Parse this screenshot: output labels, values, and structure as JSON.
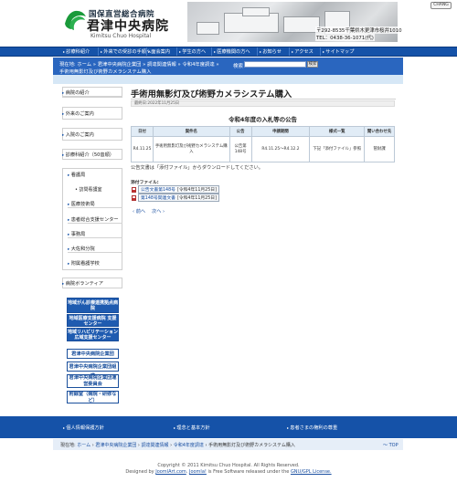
{
  "header": {
    "logo_sub": "国保直営総合病院",
    "logo_main": "君津中央病院",
    "logo_en": "Kimitsu Chuo Hospital",
    "address": "〒292-8535千葉県木更津市桜井1010",
    "phone": "TEL：0438-36-1071(代)",
    "top_button": "CHANG"
  },
  "nav": {
    "items": [
      "診療科紹介",
      "外来での受診の手順へ",
      "面会案内",
      "学生の方へ",
      "医療機関の方へ",
      "お知らせ",
      "アクセス",
      "サイトマップ"
    ]
  },
  "breadcrumb": {
    "prefix": "現在地:",
    "items": [
      "ホーム",
      "君津中央病院企業団",
      "調達関連情報",
      "令和4年度調達",
      "手術用無影灯及び術野カメラシステム購入"
    ],
    "separator": "»"
  },
  "search": {
    "label": "検索",
    "placeholder": "",
    "button": "検索"
  },
  "sidebar": {
    "items": [
      "病院の紹介",
      "外来のご案内",
      "入院のご案内",
      "診療科紹介（50音順）"
    ],
    "section_items": [
      "看護局"
    ],
    "child_items": [
      "訪問看護室"
    ],
    "more_items": [
      "医療技術局",
      "患者総合支援センター",
      "事務局",
      "大佐和分院",
      "附属看護学校"
    ],
    "volunteer": "病院ボランティア",
    "banners": [
      "地域がん診療連携拠点病院",
      "地域医療支援病院 支援センター",
      "地域リハビリテーション広域支援センター"
    ],
    "banners2": [
      "君津中央病院企業団",
      "君津中央病院企業団組織",
      "君津中央病院企業団運営委員会",
      "附録室（病院・研修など）"
    ]
  },
  "main": {
    "title": "手術用無影灯及び術野カメラシステム購入",
    "date": "最終日:2022年11月25日",
    "notice_title": "令和4年度の入札等の公告",
    "table": {
      "headers": [
        "日付",
        "案件名",
        "公告",
        "申請期間",
        "様式一覧",
        "閲い合わせ先"
      ],
      "rows": [
        [
          "R4.11.25",
          "手術用無影灯及び術野カメラシステム購入",
          "公告第148号",
          "R4.11.25～R4.12.2",
          "下記「添付ファイル」参照",
          "管財課"
        ]
      ]
    },
    "download_note": "公告文書は「添付ファイル」からダウンロードしてください。",
    "attach_label": "添付ファイル:",
    "attachments": [
      {
        "name": "公告文書第148号",
        "date": "[令和4年11月25日]"
      },
      {
        "name": "第148号関連文書",
        "date": "[令和4年11月25日]"
      }
    ],
    "prev": "前へ",
    "next": "次へ"
  },
  "footer": {
    "links": [
      "個人情報保護方針",
      "理念と基本方針",
      "患者さまの権利の尊重"
    ],
    "crumb_prefix": "現在地:",
    "crumb_items": [
      "ホーム",
      "君津中央病院企業団",
      "調達関連情報",
      "令和4年度調達",
      "手術用無影灯及び術野カメラシステム購入"
    ],
    "to_top": "～ TOP",
    "copyright": "Copyright © 2011 Kimitsu Chuo Hospital. All Rights Reserved.",
    "designed_prefix": "Designed by",
    "designed_link": "JoomlArt.com",
    "designed_mid": "Joomla!",
    "designed_suffix": "is Free Software released under the",
    "license_link": "GNU/GPL License."
  }
}
